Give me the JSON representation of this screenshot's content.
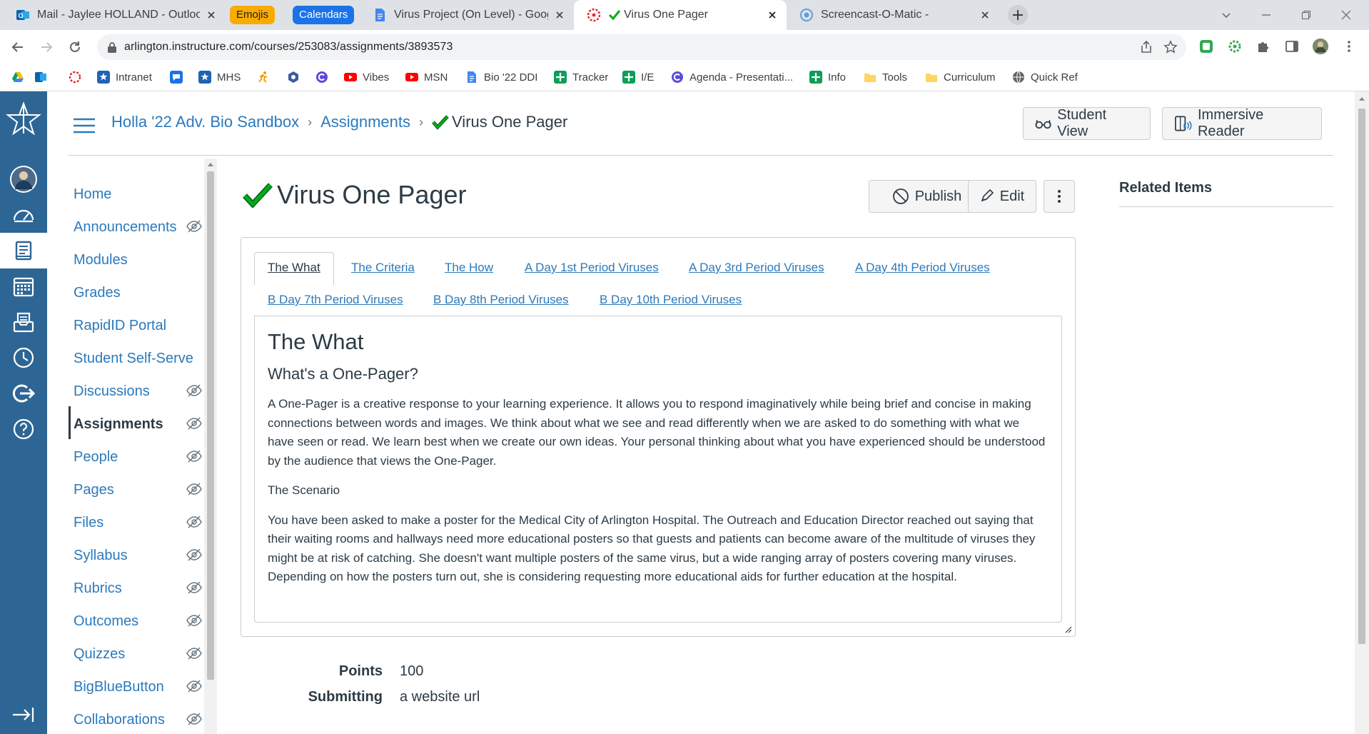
{
  "browser": {
    "tabs": [
      {
        "title": "Mail - Jaylee HOLLAND - Outlook",
        "active": false
      },
      {
        "title": "Virus Project (On Level) - Google",
        "active": false
      },
      {
        "title": "Virus One Pager",
        "active": true
      },
      {
        "title": "Screencast-O-Matic -",
        "active": false
      }
    ],
    "tab_groups": [
      {
        "label": "Emojis",
        "color": "#f9ab00"
      },
      {
        "label": "Calendars",
        "color": "#1a73e8"
      }
    ],
    "url": "arlington.instructure.com/courses/253083/assignments/3893573",
    "bookmarks": [
      {
        "label": ""
      },
      {
        "label": ""
      },
      {
        "label": ""
      },
      {
        "label": "Intranet"
      },
      {
        "label": ""
      },
      {
        "label": "MHS"
      },
      {
        "label": ""
      },
      {
        "label": ""
      },
      {
        "label": ""
      },
      {
        "label": "Vibes"
      },
      {
        "label": "MSN"
      },
      {
        "label": "Bio '22 DDI"
      },
      {
        "label": "Tracker"
      },
      {
        "label": "I/E"
      },
      {
        "label": "Agenda - Presentati..."
      },
      {
        "label": "Info"
      },
      {
        "label": "Tools"
      },
      {
        "label": "Curriculum"
      },
      {
        "label": "Quick Ref"
      }
    ]
  },
  "breadcrumb": {
    "course": "Holla '22 Adv. Bio Sandbox",
    "section": "Assignments",
    "current": "Virus One Pager"
  },
  "header_buttons": {
    "student_view": "Student View",
    "immersive_reader": "Immersive Reader"
  },
  "course_nav": [
    {
      "label": "Home",
      "hidden": false
    },
    {
      "label": "Announcements",
      "hidden": true
    },
    {
      "label": "Modules",
      "hidden": false
    },
    {
      "label": "Grades",
      "hidden": false
    },
    {
      "label": "RapidID Portal",
      "hidden": false
    },
    {
      "label": "Student Self-Serve",
      "hidden": false
    },
    {
      "label": "Discussions",
      "hidden": true
    },
    {
      "label": "Assignments",
      "hidden": true,
      "active": true
    },
    {
      "label": "People",
      "hidden": true
    },
    {
      "label": "Pages",
      "hidden": true
    },
    {
      "label": "Files",
      "hidden": true
    },
    {
      "label": "Syllabus",
      "hidden": true
    },
    {
      "label": "Rubrics",
      "hidden": true
    },
    {
      "label": "Outcomes",
      "hidden": true
    },
    {
      "label": "Quizzes",
      "hidden": true
    },
    {
      "label": "BigBlueButton",
      "hidden": true
    },
    {
      "label": "Collaborations",
      "hidden": true
    }
  ],
  "assignment": {
    "title": "Virus One Pager",
    "publish_label": "Publish",
    "edit_label": "Edit",
    "tabs": [
      "The What",
      "The Criteria",
      "The How",
      "A Day 1st Period Viruses",
      "A Day 3rd Period Viruses",
      "A Day 4th Period Viruses",
      "B Day 7th Period Viruses",
      "B Day 8th Period Viruses",
      "B Day 10th Period Viruses"
    ],
    "content": {
      "heading": "The What",
      "subheading": "What's a One-Pager?",
      "para1": "A One-Pager is a creative response to your learning experience. It allows you to respond imaginatively while being brief and concise in making connections between words and images. We think about what we see and read differently when we are asked to do something with what we have seen or read. We learn best when we create our own ideas. Your personal thinking about what you have experienced should be understood by the audience that views the One-Pager.",
      "scenario_label": "The Scenario",
      "para2": "You have been asked to make a poster for the Medical City of Arlington Hospital. The Outreach and Education Director reached out saying that their waiting rooms and hallways need more educational posters so that guests and patients can become aware of the multitude of viruses they might be at risk of catching. She doesn't want multiple posters of the same virus, but a wide ranging array of posters covering many viruses. Depending on how the posters turn out, she is considering requesting more educational aids for further education at the hospital."
    },
    "details": {
      "points_label": "Points",
      "points_value": "100",
      "submitting_label": "Submitting",
      "submitting_value": "a website url"
    }
  },
  "related_items_label": "Related Items",
  "colors": {
    "canvas_nav": "#2d6694",
    "link": "#2b7abc",
    "text": "#2d3b45",
    "check": "#00ac18"
  }
}
